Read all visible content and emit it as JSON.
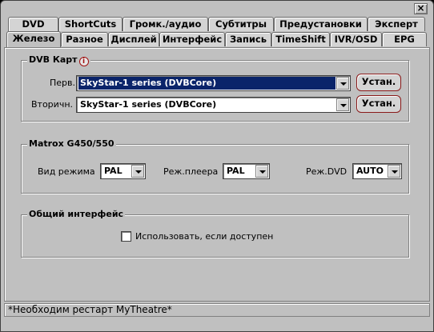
{
  "tabs_row1": [
    {
      "label": "DVD"
    },
    {
      "label": "ShortCuts"
    },
    {
      "label": "Громк./аудио"
    },
    {
      "label": "Субтитры"
    },
    {
      "label": "Предустановки"
    },
    {
      "label": "Эксперт"
    }
  ],
  "tabs_row2": [
    {
      "label": "Железо"
    },
    {
      "label": "Разное"
    },
    {
      "label": "Дисплей"
    },
    {
      "label": "Интерфейс"
    },
    {
      "label": "Запись"
    },
    {
      "label": "TimeShift"
    },
    {
      "label": "IVR/OSD"
    },
    {
      "label": "EPG"
    }
  ],
  "active_tab": "Железо",
  "close_glyph": "×",
  "dvb": {
    "title": "DVB Карт",
    "info_glyph": "i",
    "primary_label": "Перв.",
    "primary_value": "SkyStar-1 series (DVBCore)",
    "primary_button": "Устан.",
    "secondary_label": "Вторичн.",
    "secondary_value": "SkyStar-1 series (DVBCore)",
    "secondary_button": "Устан."
  },
  "matrox": {
    "title": "Matrox G450/550",
    "mode_label": "Вид режима",
    "mode_value": "PAL",
    "player_label": "Реж.плеера",
    "player_value": "PAL",
    "dvd_label": "Реж.DVD",
    "dvd_value": "AUTO"
  },
  "common": {
    "title": "Общий интерфейс",
    "checkbox_label": "Использовать, если доступен",
    "checked": false
  },
  "status": "*Необходим рестарт MyTheatre*"
}
